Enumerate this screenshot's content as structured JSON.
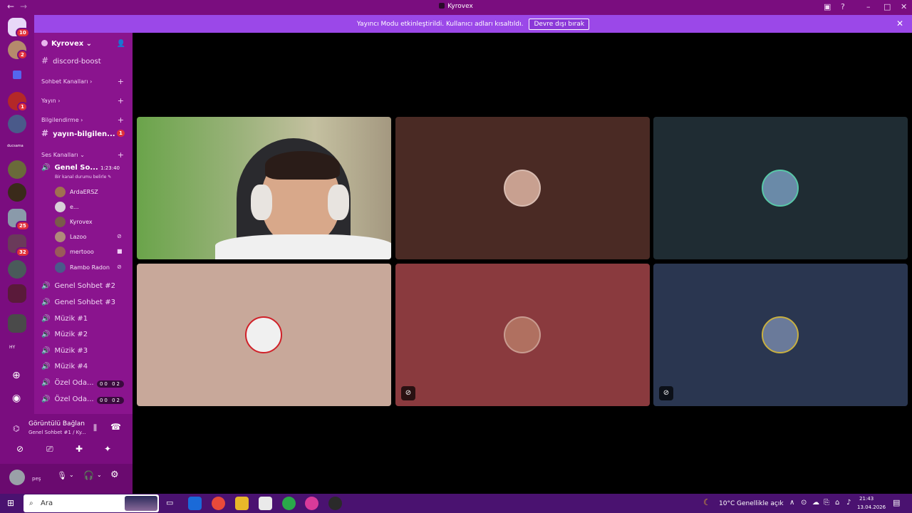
{
  "window": {
    "title": "Kyrovex"
  },
  "banner": {
    "text": "Yayıncı Modu etkinleştirildi. Kullanıcı adları kısaltıldı.",
    "button_label": "Devre dışı bırak"
  },
  "rail": {
    "badges": [
      "10",
      "2",
      "1",
      "25",
      "32"
    ],
    "labels": {
      "ducsama": "ducsama",
      "hy": "HY"
    }
  },
  "server": {
    "name": "Kyrovex"
  },
  "channels": {
    "top": "discord-boost",
    "cat_chat": "Sohbet Kanalları",
    "cat_stream": "Yayın",
    "cat_info": "Bilgilendirme",
    "info_channel": "yayın-bilgilen...",
    "info_badge": "1",
    "cat_voice": "Ses Kanalları",
    "active_voice": "Genel So...",
    "active_timer": "1:23:40",
    "active_status": "Bir kanal durumu belirle",
    "users": [
      "ArdaERSZ",
      "e...",
      "Kyrovex",
      "Lazoo",
      "mertooo",
      "Rambo Radon"
    ],
    "voice_channels": [
      "Genel Sohbet #2",
      "Genel Sohbet #3",
      "Müzik #1",
      "Müzik #2",
      "Müzik #3",
      "Müzik #4"
    ],
    "private_rooms": [
      {
        "name": "Özel Oda...",
        "count": "00  02"
      },
      {
        "name": "Özel Oda...",
        "count": "00  02"
      }
    ]
  },
  "voice": {
    "status": "Görüntülü Bağlan",
    "channel": "Genel Sohbet #1 / Ky...",
    "user_status": "peş"
  },
  "taskbar": {
    "search_placeholder": "Ara",
    "weather": "10°C",
    "weather_desc": "Genellikle açık",
    "time": "21:43",
    "date": "13.04.2026"
  },
  "colors": {
    "titlebar": "#7a0d7f",
    "sidebar": "#8a148e",
    "banner": "#9b48e8",
    "tile_1": "#4a2a24",
    "tile_2": "#1f2c33",
    "tile_3": "#c8a89a",
    "tile_4": "#8a3a3e",
    "tile_5": "#2a3650"
  }
}
